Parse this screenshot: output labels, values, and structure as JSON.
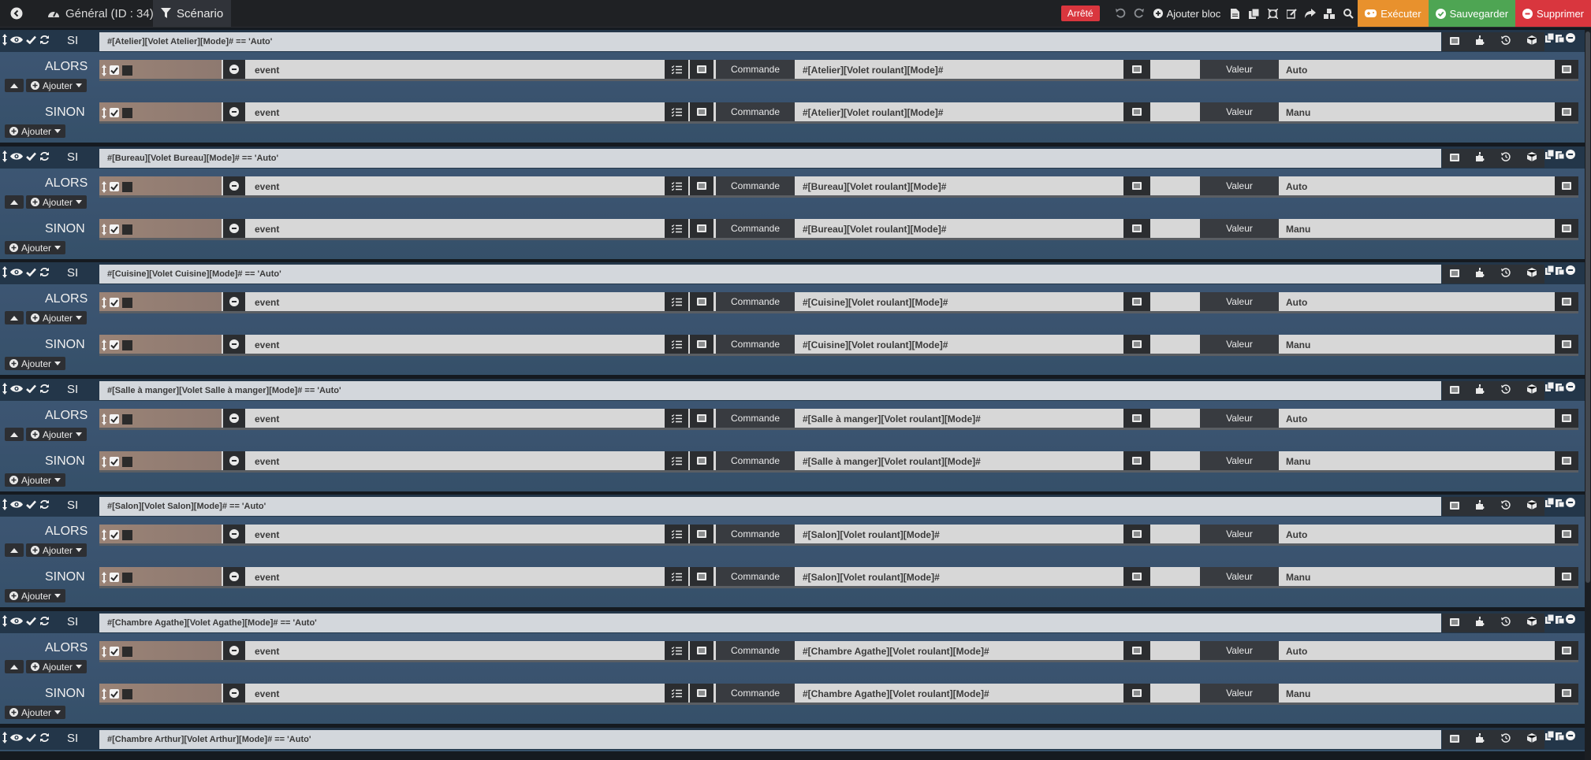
{
  "header": {
    "tabs": [
      {
        "label": "Général (ID : 34)",
        "icon": "dashboard-icon"
      },
      {
        "label": "Scénario",
        "icon": "filter-icon"
      }
    ],
    "status": "Arrêté",
    "add_block_label": "Ajouter bloc",
    "execute_label": "Exécuter",
    "save_label": "Sauvegarder",
    "delete_label": "Supprimer"
  },
  "labels": {
    "si": "SI",
    "alors": "ALORS",
    "sinon": "SINON",
    "ajouter": "Ajouter",
    "commande": "Commande",
    "valeur": "Valeur"
  },
  "colors": {
    "status_badge": "#d9363e",
    "execute": "#e8912d",
    "save": "#4ea553",
    "delete": "#d9363e",
    "block_background": "#3e5774"
  },
  "blocks": [
    {
      "condition": "#[Atelier][Volet Atelier][Mode]# == 'Auto'",
      "alors": {
        "type": "event",
        "command": "#[Atelier][Volet roulant][Mode]#",
        "value": "Auto"
      },
      "sinon": {
        "type": "event",
        "command": "#[Atelier][Volet roulant][Mode]#",
        "value": "Manu"
      }
    },
    {
      "condition": "#[Bureau][Volet Bureau][Mode]# == 'Auto'",
      "alors": {
        "type": "event",
        "command": "#[Bureau][Volet roulant][Mode]#",
        "value": "Auto"
      },
      "sinon": {
        "type": "event",
        "command": "#[Bureau][Volet roulant][Mode]#",
        "value": "Manu"
      }
    },
    {
      "condition": "#[Cuisine][Volet Cuisine][Mode]# == 'Auto'",
      "alors": {
        "type": "event",
        "command": "#[Cuisine][Volet roulant][Mode]#",
        "value": "Auto"
      },
      "sinon": {
        "type": "event",
        "command": "#[Cuisine][Volet roulant][Mode]#",
        "value": "Manu"
      }
    },
    {
      "condition": "#[Salle à manger][Volet Salle à manger][Mode]# == 'Auto'",
      "alors": {
        "type": "event",
        "command": "#[Salle à manger][Volet roulant][Mode]#",
        "value": "Auto"
      },
      "sinon": {
        "type": "event",
        "command": "#[Salle à manger][Volet roulant][Mode]#",
        "value": "Manu"
      }
    },
    {
      "condition": "#[Salon][Volet Salon][Mode]# == 'Auto'",
      "alors": {
        "type": "event",
        "command": "#[Salon][Volet roulant][Mode]#",
        "value": "Auto"
      },
      "sinon": {
        "type": "event",
        "command": "#[Salon][Volet roulant][Mode]#",
        "value": "Manu"
      }
    },
    {
      "condition": "#[Chambre Agathe][Volet Agathe][Mode]# == 'Auto'",
      "alors": {
        "type": "event",
        "command": "#[Chambre Agathe][Volet roulant][Mode]#",
        "value": "Auto"
      },
      "sinon": {
        "type": "event",
        "command": "#[Chambre Agathe][Volet roulant][Mode]#",
        "value": "Manu"
      }
    },
    {
      "condition": "#[Chambre Arthur][Volet Arthur][Mode]# == 'Auto'"
    }
  ]
}
